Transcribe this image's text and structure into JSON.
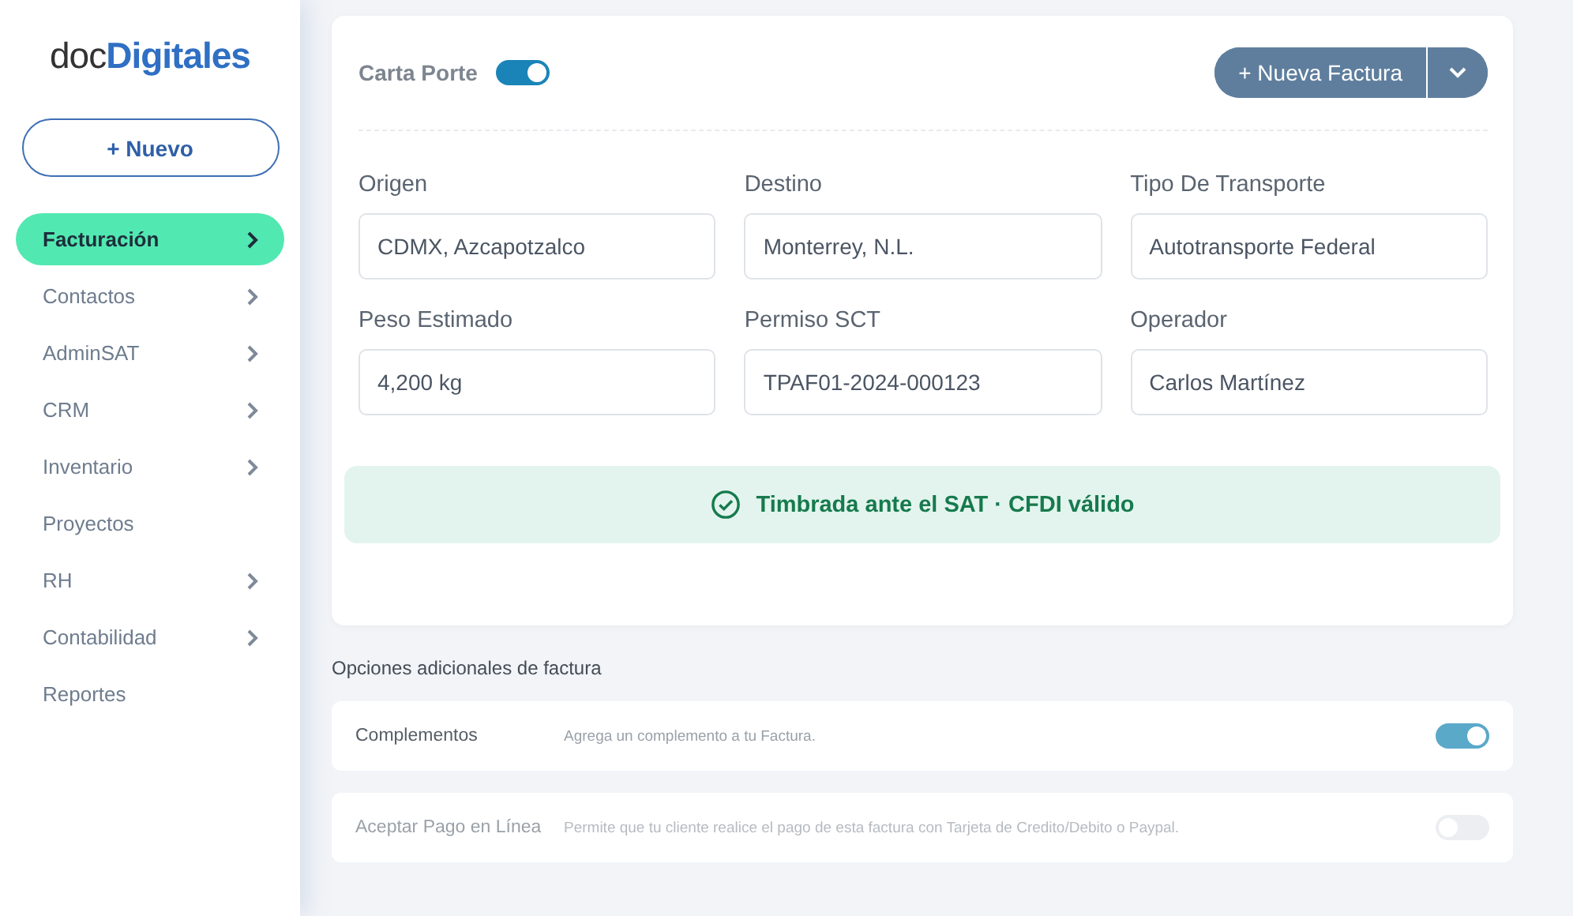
{
  "sidebar": {
    "logo": "doc**Digitales**",
    "new_button": "+ Nuevo",
    "items": [
      {
        "label": "Facturación",
        "selected": true,
        "chevron": true
      },
      {
        "label": "Contactos",
        "selected": false,
        "chevron": true
      },
      {
        "label": "AdminSAT",
        "selected": false,
        "chevron": true
      },
      {
        "label": "CRM",
        "selected": false,
        "chevron": true
      },
      {
        "label": "Inventario",
        "selected": false,
        "chevron": true
      },
      {
        "label": "Proyectos",
        "selected": false,
        "chevron": false
      },
      {
        "label": "RH",
        "selected": false,
        "chevron": true
      },
      {
        "label": "Contabilidad",
        "selected": false,
        "chevron": true
      },
      {
        "label": "Reportes",
        "selected": false,
        "chevron": false
      }
    ]
  },
  "header": {
    "toggle_label": "Carta Porte",
    "toggle_on": true,
    "button": "+ Nueva Factura"
  },
  "fields": [
    {
      "label": "Origen",
      "value": "CDMX, Azcapotzalco"
    },
    {
      "label": "Destino",
      "value": "Monterrey, N.L."
    },
    {
      "label": "Tipo De Transporte",
      "value": "Autotransporte Federal"
    },
    {
      "label": "Peso Estimado",
      "value": "4,200 kg"
    },
    {
      "label": "Permiso SCT",
      "value": "TPAF01-2024-000123"
    },
    {
      "label": "Operador",
      "value": "Carlos Martínez"
    }
  ],
  "status": "Timbrada ante el SAT · CFDI válido",
  "options_title": "Opciones adicionales de factura",
  "options": [
    {
      "name": "Complementos",
      "description": "Agrega un complemento a tu Factura.",
      "on": true,
      "disabled": false
    },
    {
      "name": "Aceptar Pago en Línea",
      "description": "Permite que tu cliente realice el pago de esta factura con Tarjeta de Credito/Debito o Paypal.",
      "on": false,
      "disabled": true
    }
  ]
}
